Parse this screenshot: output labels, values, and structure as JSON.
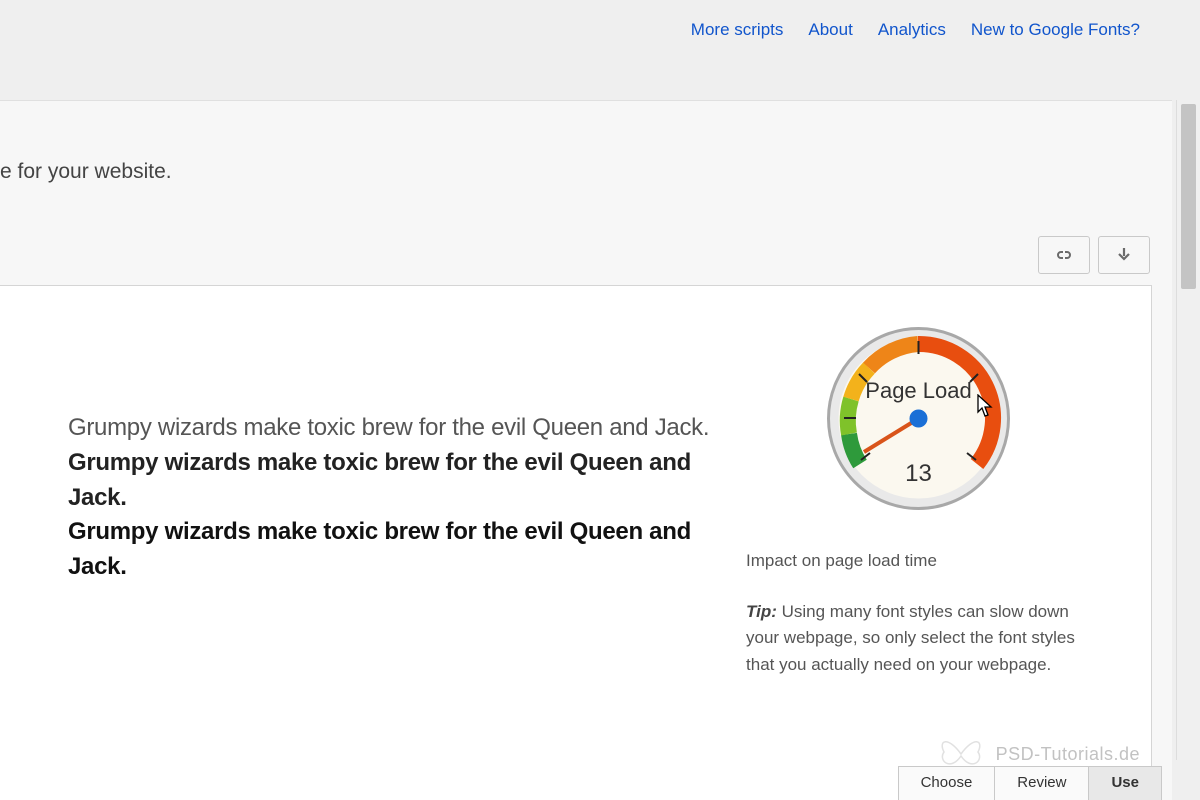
{
  "nav": {
    "more_scripts": "More scripts",
    "about": "About",
    "analytics": "Analytics",
    "new_to": "New to Google Fonts?"
  },
  "subheader_fragment": "e for your website.",
  "samples": {
    "line1": "Grumpy wizards make toxic brew for the evil Queen and Jack.",
    "line2": "Grumpy wizards make toxic brew for the evil Queen and Jack.",
    "line3": "Grumpy wizards make toxic brew for the evil Queen and Jack."
  },
  "gauge": {
    "label": "Page Load",
    "value": "13"
  },
  "sidebar": {
    "impact": "Impact on page load time",
    "tip_label": "Tip:",
    "tip_body": " Using many font styles can slow down your webpage, so only select the font styles that you actually need on your webpage."
  },
  "tabs": {
    "choose": "Choose",
    "review": "Review",
    "use": "Use"
  },
  "watermark": "PSD-Tutorials.de",
  "icons": {
    "link": "link-icon",
    "download": "download-icon"
  }
}
